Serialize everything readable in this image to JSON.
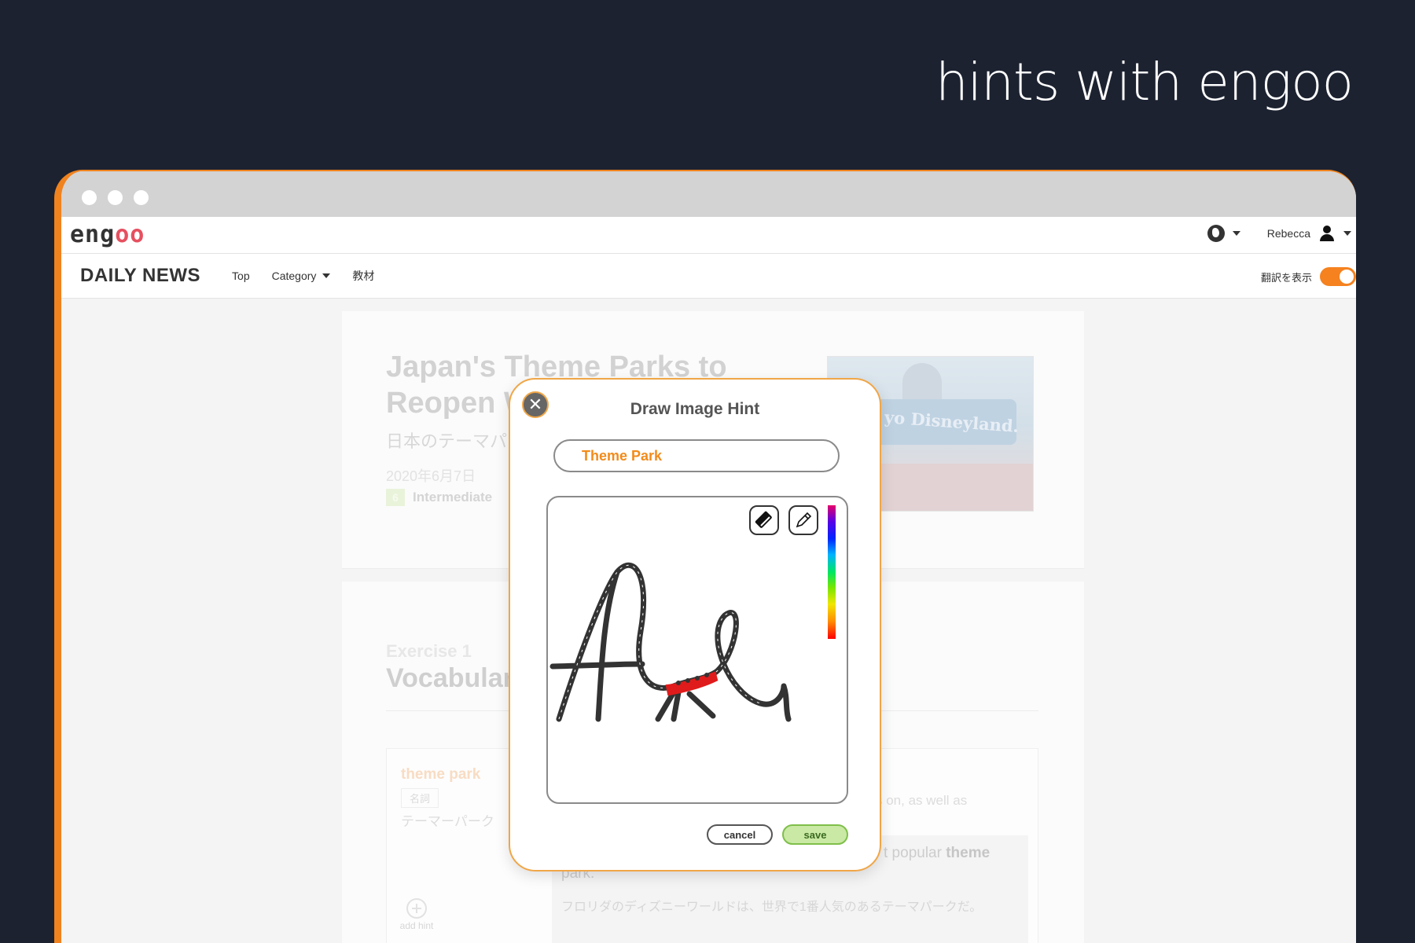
{
  "promo": {
    "title": "hints with engoo"
  },
  "topbar": {
    "logo_prefix": "eng",
    "logo_suffix": "oo",
    "user_name": "Rebecca"
  },
  "navbar": {
    "brand": "DAILY NEWS",
    "links": [
      "Top",
      "Category",
      "教材"
    ],
    "translate_label": "翻訳を表示",
    "translate_on": true
  },
  "article": {
    "title": "Japan's Theme Parks to Reopen W",
    "subtitle": "日本のテーマパ",
    "date": "2020年6月7日",
    "level_number": "6",
    "level_label": "Intermediate",
    "image_sign_text": "yo Disneyland."
  },
  "exercise": {
    "label": "Exercise 1",
    "title": "Vocabular",
    "vocab_word": "theme park",
    "vocab_pos": "名詞",
    "vocab_jp": "テーマーパーク",
    "add_hint_label": "add hint",
    "definition_tail": "s on, as well as",
    "example_tail_prefix": "t popular ",
    "example_tail_bold": "theme",
    "example_line2": "park.",
    "example_jp": "フロリダのディズニーワールドは、世界で1番人気のあるテーマパークだ。"
  },
  "modal": {
    "title": "Draw Image Hint",
    "hint_value": "Theme Park",
    "cancel_label": "cancel",
    "save_label": "save",
    "close_glyph": "✕",
    "colors": {
      "accent": "#f0a647",
      "input_text": "#f28b1b",
      "save_bg": "#c9e9a5",
      "stroke": "#333333",
      "car": "#e01b1b"
    }
  }
}
